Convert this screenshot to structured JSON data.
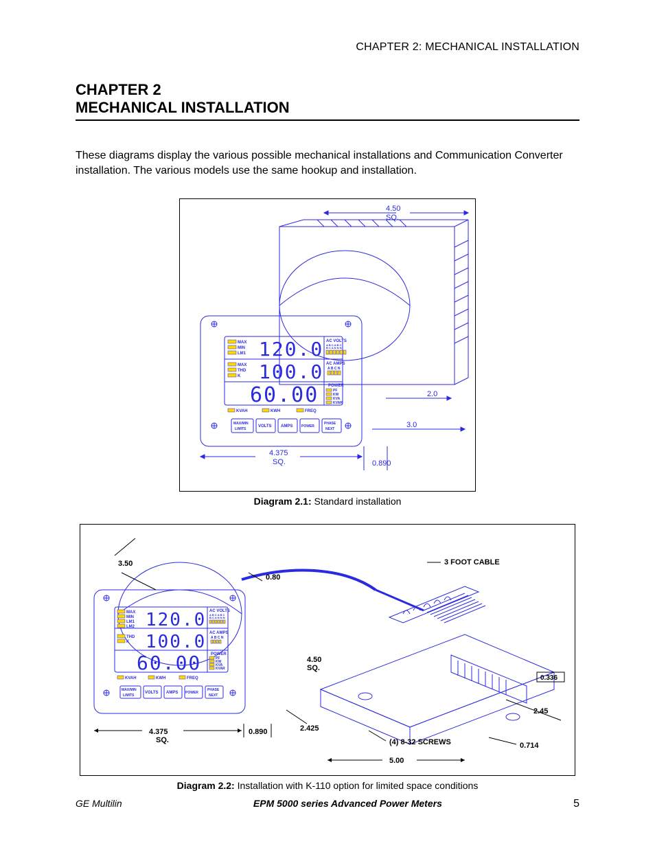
{
  "header": {
    "running": "CHAPTER 2: MECHANICAL INSTALLATION"
  },
  "chapter": {
    "line1": "CHAPTER 2",
    "line2": "MECHANICAL INSTALLATION"
  },
  "intro": "These diagrams display the various possible mechanical installations and Communication Converter installation. The various models use the same hookup and installation.",
  "fig1": {
    "caption_label": "Diagram 2.1:",
    "caption_text": " Standard installation",
    "dim_top": "4.50",
    "dim_top_sq": "SQ.",
    "dim_right_1": "2.0",
    "dim_right_2": "3.0",
    "dim_bottom": "4.375",
    "dim_bottom_sq": "SQ.",
    "dim_depth": "0.890",
    "meter": {
      "title_volts": "AC VOLTS",
      "volts_top": "A B C A B C",
      "volts_bot": "B C A N N N",
      "title_amps": "AC AMPS",
      "amps_top": "A B C N",
      "title_power": "POWER",
      "pf": "PF",
      "kw": "KW",
      "kva": "KVA",
      "kvar": "KVAR",
      "bar_kvah": "KVAH",
      "bar_kwh": "KWH",
      "bar_freq": "FREQ",
      "left": {
        "max": "MAX",
        "min": "MIN",
        "lm1": "LM1",
        "max2": "MAX",
        "thd": "THD",
        "k": "K"
      },
      "display_volts": "120.0",
      "display_amps": "100.0",
      "display_power": "60.00",
      "btn1a": "MAX/MIN",
      "btn1b": "LIMITS",
      "btn2": "VOLTS",
      "btn3": "AMPS",
      "btn4": "POWER",
      "btn5a": "PHASE",
      "btn5b": "NEXT"
    }
  },
  "fig2": {
    "caption_label": "Diagram 2.2:",
    "caption_text": " Installation with K-110 option for limited space conditions",
    "dim_350": "3.50",
    "dim_080": "0.80",
    "dim_cable": "3 FOOT CABLE",
    "dim_450": "4.50",
    "dim_450_sq": "SQ.",
    "dim_2425": "2.425",
    "dim_4375": "4.375",
    "dim_4375_sq": "SQ.",
    "dim_0890": "0.890",
    "dim_screws": "(4) 8-32 SCREWS",
    "dim_500": "5.00",
    "dim_0336": "0.336",
    "dim_245": "2.45",
    "dim_0714": "0.714",
    "meter": {
      "title_volts": "AC VOLTS",
      "volts_top": "A B C A B C",
      "volts_bot": "B C A N N N",
      "title_amps": "AC AMPS",
      "amps_top": "A B C N",
      "title_power": "POWER",
      "pf": "PF",
      "kw": "KW",
      "kva": "KVA",
      "kvar": "KVAR",
      "bar_kvah": "KVAH",
      "bar_kwh": "KWH",
      "bar_freq": "FREQ",
      "left": {
        "max": "MAX",
        "min": "MIN",
        "lm1": "LM1",
        "lm2": "LM2",
        "thd": "THD",
        "k": "K"
      },
      "display_volts": "120.0",
      "display_amps": "100.0",
      "display_power": "60.00",
      "btn1a": "MAX/MIN",
      "btn1b": "LIMITS",
      "btn2": "VOLTS",
      "btn3": "AMPS",
      "btn4": "POWER",
      "btn5a": "PHASE",
      "btn5b": "NEXT"
    }
  },
  "footer": {
    "left": "GE Multilin",
    "center": "EPM 5000 series Advanced Power Meters",
    "right": "5"
  }
}
